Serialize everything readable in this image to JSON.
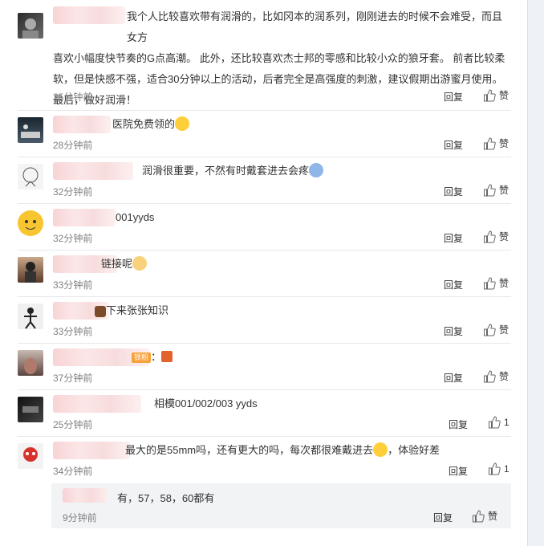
{
  "comments": [
    {
      "text_lines": [
        "我个人比较喜欢带有润滑的，比如冈本的润系列，刚刚进去的时候不会难受，而且女方",
        "喜欢小幅度快节奏的G点高潮。 此外，还比较喜欢杰士邦的零感和比较小众的狼牙套。 前者比较柔",
        "软，但是快感不强，适合30分钟以上的活动，后者完全是高强度的刺激，建议假期出游蜜月使用。",
        "最后，做好润滑！"
      ],
      "time": "25分钟前",
      "reply": "回复",
      "like": "赞"
    },
    {
      "text": "医院免费领的",
      "time": "28分钟前",
      "reply": "回复",
      "like": "赞"
    },
    {
      "text": "润滑很重要，不然有时戴套进去会疼",
      "time": "32分钟前",
      "reply": "回复",
      "like": "赞"
    },
    {
      "text": "001yyds",
      "time": "32分钟前",
      "reply": "回复",
      "like": "赞"
    },
    {
      "text": "链接呢",
      "time": "33分钟前",
      "reply": "回复",
      "like": "赞"
    },
    {
      "text": "下来张张知识",
      "time": "33分钟前",
      "reply": "回复",
      "like": "赞"
    },
    {
      "text": "：",
      "badge": "铁粉",
      "time": "37分钟前",
      "reply": "回复",
      "like": "赞"
    },
    {
      "text": "相模001/002/003 yyds",
      "time": "25分钟前",
      "reply": "回复",
      "like": "1"
    },
    {
      "text": "最大的是55mm吗，还有更大的吗，每次都很难戴进去",
      "text_after": "，体验好差",
      "time": "34分钟前",
      "reply": "回复",
      "like": "1"
    }
  ],
  "sub_reply": {
    "text": "有，57，58，60都有",
    "time": "9分钟前",
    "reply": "回复",
    "like": "赞"
  },
  "colors": {
    "accent": "#ff8200",
    "text": "#333333",
    "muted": "#808080",
    "blur": "#f7cfd1"
  }
}
